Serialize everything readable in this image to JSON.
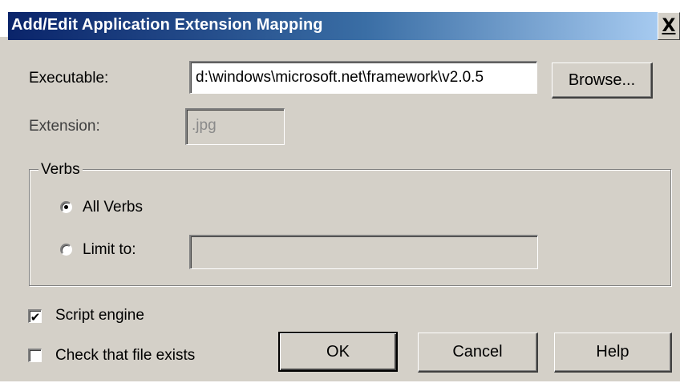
{
  "window": {
    "title": "Add/Edit Application Extension Mapping",
    "close_glyph": "X",
    "close_icon": "close-icon"
  },
  "executable": {
    "label": "Executable:",
    "value": "d:\\windows\\microsoft.net\\framework\\v2.0.5"
  },
  "browse_button": {
    "label": "Browse..."
  },
  "extension": {
    "label": "Extension:",
    "value": ".jpg"
  },
  "verbs": {
    "group_label": "Verbs",
    "all_verbs": {
      "label": "All Verbs",
      "selected": true
    },
    "limit_to": {
      "label": "Limit to:",
      "selected": false,
      "value": ""
    }
  },
  "options": {
    "script_engine": {
      "label": "Script engine",
      "checked": true
    },
    "check_file_exists": {
      "label": "Check that file exists",
      "checked": false
    }
  },
  "buttons": {
    "ok": "OK",
    "cancel": "Cancel",
    "help": "Help"
  },
  "colors": {
    "dialog_background": "#d4d0c8",
    "titlebar_start": "#0a246a",
    "titlebar_end": "#a6caf0",
    "title_text": "#ffffff"
  }
}
